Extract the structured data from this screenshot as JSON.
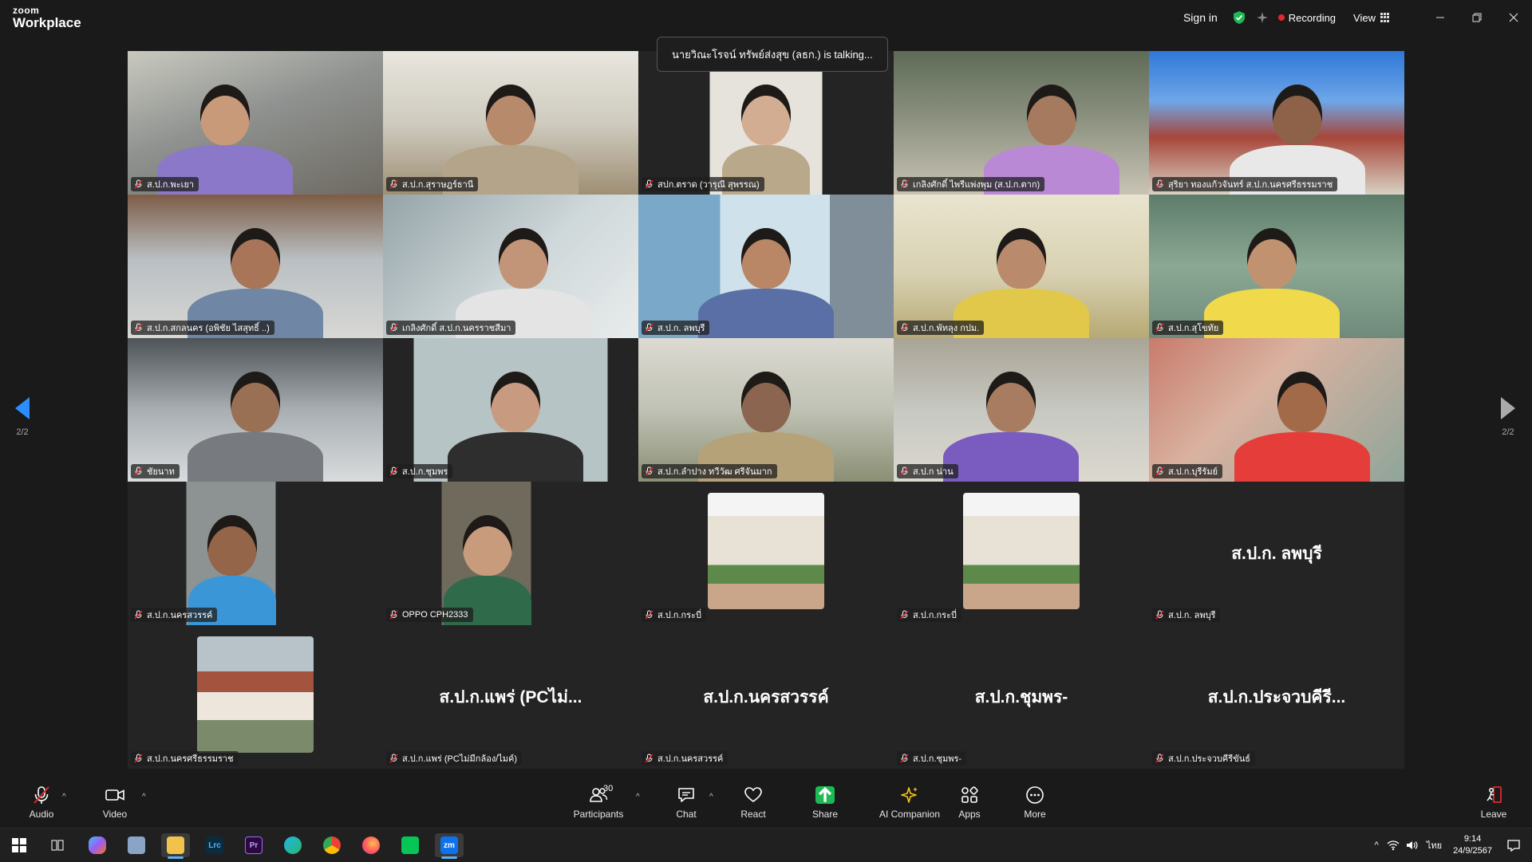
{
  "app": {
    "brand_small": "zoom",
    "brand_name": "Workplace",
    "sign_in": "Sign in",
    "recording_label": "Recording",
    "view_label": "View",
    "talking_indicator": "นายวิณะโรจน์ ทรัพย์ส่งสุข (ลธก.) is talking...",
    "page_left": "2/2",
    "page_right": "2/2",
    "colors": {
      "accent": "#0e72ed",
      "recording": "#e0282d",
      "share": "#1db954",
      "muted": "#e0282d"
    }
  },
  "participants": [
    {
      "name": "ส.ป.ก.พะเยา",
      "muted": true,
      "display": "video"
    },
    {
      "name": "ส.ป.ก.สุราษฎร์ธานี",
      "muted": true,
      "display": "video"
    },
    {
      "name": "สปก.ตราด (วารุณี สุพรรณ)",
      "muted": true,
      "display": "video"
    },
    {
      "name": "เกลิงศักดิ์ ไพรีแพ่งพุม (ส.ป.ก.ตาก)",
      "muted": true,
      "display": "video"
    },
    {
      "name": "สุริยา ทองแก้วจันทร์ ส.ป.ก.นครศรีธรรมราช",
      "muted": true,
      "display": "video"
    },
    {
      "name": "ส.ป.ก.สกลนคร (อพิชัย ไสสุทธิ์ ..)",
      "muted": true,
      "display": "video"
    },
    {
      "name": "เกลิงศักดิ์ ส.ป.ก.นครราชสีมา",
      "muted": true,
      "display": "video"
    },
    {
      "name": "ส.ป.ก. ลพบุรี",
      "muted": true,
      "display": "video"
    },
    {
      "name": "ส.ป.ก.พัทลุง กปม.",
      "muted": true,
      "display": "video"
    },
    {
      "name": "ส.ป.ก.สุโขทัย",
      "muted": true,
      "display": "video"
    },
    {
      "name": "ชัยนาท",
      "muted": true,
      "display": "video"
    },
    {
      "name": "ส.ป.ก.ชุมพร",
      "muted": true,
      "display": "video"
    },
    {
      "name": "ส.ป.ก.ลำปาง ทวีวัฒ ศรีจันมาก",
      "muted": true,
      "display": "video"
    },
    {
      "name": "ส.ป.ก น่าน",
      "muted": true,
      "display": "video"
    },
    {
      "name": "ส.ป.ก.บุรีรัมย์",
      "muted": true,
      "display": "video"
    },
    {
      "name": "ส.ป.ก.นครสวรรค์",
      "muted": true,
      "display": "video"
    },
    {
      "name": "OPPO CPH2333",
      "muted": true,
      "display": "video"
    },
    {
      "name": "ส.ป.ก.กระบี่",
      "muted": true,
      "display": "photo"
    },
    {
      "name": "ส.ป.ก.กระบี่",
      "muted": true,
      "display": "photo"
    },
    {
      "name": "ส.ป.ก. ลพบุรี",
      "muted": true,
      "display": "text",
      "big_label": "ส.ป.ก. ลพบุรี"
    },
    {
      "name": "ส.ป.ก.นครศรีธรรมราช",
      "muted": true,
      "display": "photo"
    },
    {
      "name": "ส.ป.ก.แพร่ (PCไม่มีกล้อง/ไมค์)",
      "muted": true,
      "display": "text",
      "big_label": "ส.ป.ก.แพร่ (PCไม่..."
    },
    {
      "name": "ส.ป.ก.นครสวรรค์",
      "muted": true,
      "display": "text",
      "big_label": "ส.ป.ก.นครสวรรค์"
    },
    {
      "name": "ส.ป.ก.ชุมพร-",
      "muted": true,
      "display": "text",
      "big_label": "ส.ป.ก.ชุมพร-"
    },
    {
      "name": "ส.ป.ก.ประจวบคีรีขันธ์",
      "muted": true,
      "display": "text",
      "big_label": "ส.ป.ก.ประจวบคีรี..."
    }
  ],
  "toolbar": {
    "audio": "Audio",
    "video": "Video",
    "participants": "Participants",
    "participants_count": "30",
    "chat": "Chat",
    "react": "React",
    "share": "Share",
    "ai_companion": "AI Companion",
    "apps": "Apps",
    "more": "More",
    "leave": "Leave"
  },
  "taskbar": {
    "lrc_label": "Lrc",
    "pr_label": "Pr",
    "zm_label": "zm",
    "language": "ไทย",
    "time": "9:14",
    "date": "24/9/2567"
  }
}
